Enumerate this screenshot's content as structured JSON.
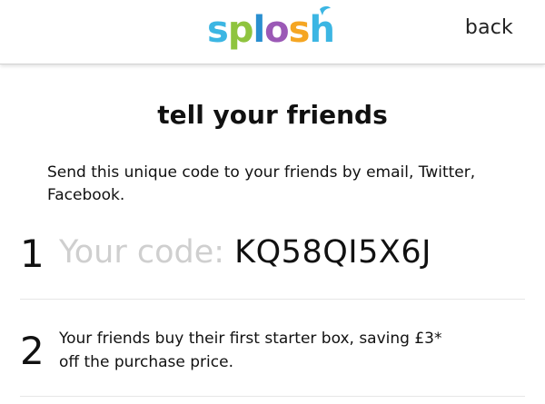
{
  "header": {
    "logo_text": "splosh",
    "back_label": "back"
  },
  "page": {
    "title": "tell your friends",
    "intro": "Send this unique code to your friends by email, Twitter, Facebook."
  },
  "steps": [
    {
      "number": "1",
      "code_label": "Your code: ",
      "code_value": "KQ58QI5X6J"
    },
    {
      "number": "2",
      "text": "Your friends buy their first starter box, saving £3* off the purchase price."
    }
  ],
  "colors": {
    "logo_s": "#3cb6e3",
    "logo_p": "#8fc43f",
    "logo_l": "#2a8fd0",
    "logo_o": "#9b59b6",
    "logo_s2": "#f5a623",
    "logo_h": "#3cb6e3",
    "code_label": "#cfcfcf"
  }
}
